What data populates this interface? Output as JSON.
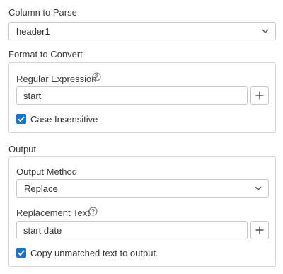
{
  "column_to_parse": {
    "label": "Column to Parse",
    "selected": "header1"
  },
  "format_to_convert": {
    "label": "Format to Convert",
    "regular_expression": {
      "label": "Regular Expression",
      "value": "start"
    },
    "case_insensitive": {
      "label": "Case Insensitive",
      "checked": true
    }
  },
  "output": {
    "label": "Output",
    "output_method": {
      "label": "Output Method",
      "selected": "Replace"
    },
    "replacement_text": {
      "label": "Replacement Text",
      "value": "start date"
    },
    "copy_unmatched": {
      "label": "Copy unmatched text to output.",
      "checked": true
    }
  },
  "colors": {
    "accent": "#1a73c8",
    "border": "#c8c8c8",
    "icon": "#5a5a5a"
  },
  "icons": [
    "chevron-down-icon",
    "help-circle-icon",
    "plus-icon",
    "checkmark-icon"
  ]
}
